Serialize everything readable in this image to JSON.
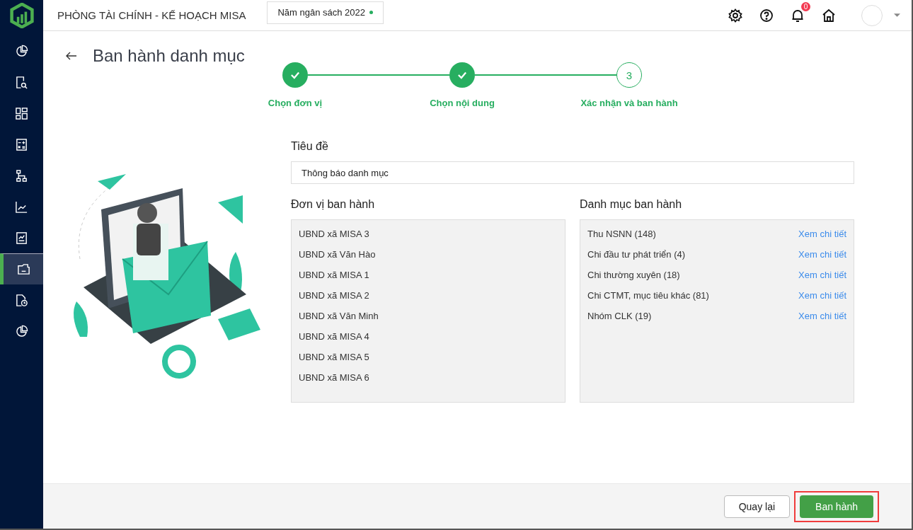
{
  "sidebar": {
    "items": [
      {
        "kind": "pie",
        "selected": false
      },
      {
        "kind": "docsearch",
        "selected": false
      },
      {
        "kind": "dashboard",
        "selected": false
      },
      {
        "kind": "calculator",
        "selected": false
      },
      {
        "kind": "hierarchy",
        "selected": false
      },
      {
        "kind": "linechart",
        "selected": false
      },
      {
        "kind": "report",
        "selected": false
      },
      {
        "kind": "folder",
        "selected": true
      },
      {
        "kind": "docclock",
        "selected": false
      },
      {
        "kind": "pie",
        "selected": false
      }
    ]
  },
  "header": {
    "title": "PHÒNG TÀI CHÍNH - KẾ HOẠCH MISA",
    "budget_year": "Năm ngân sách 2022",
    "notification_count": "0"
  },
  "page": {
    "title": "Ban hành danh mục"
  },
  "steps": [
    {
      "label": "Chọn đơn vị",
      "done": true
    },
    {
      "label": "Chọn nội dung",
      "done": true
    },
    {
      "label": "Xác nhận và ban hành",
      "done": false,
      "number": "3"
    }
  ],
  "form": {
    "title_label": "Tiêu đề",
    "title_value": "Thông báo danh mục",
    "units_label": "Đơn vị ban hành",
    "units": [
      "UBND xã MISA 3",
      "UBND xã Văn Hào",
      "UBND xã MISA 1",
      "UBND xã MISA 2",
      "UBND xã Văn Minh",
      "UBND xã MISA 4",
      "UBND xã MISA 5",
      "UBND xã MISA 6"
    ],
    "categories_label": "Danh mục ban hành",
    "categories": [
      {
        "name": "Thu NSNN (148)",
        "link": "Xem chi tiết"
      },
      {
        "name": "Chi đầu tư phát triển (4)",
        "link": "Xem chi tiết"
      },
      {
        "name": "Chi thường xuyên (18)",
        "link": "Xem chi tiết"
      },
      {
        "name": "Chi CTMT, mục tiêu khác (81)",
        "link": "Xem chi tiết"
      },
      {
        "name": "Nhóm CLK (19)",
        "link": "Xem chi tiết"
      }
    ]
  },
  "footer": {
    "buttons": [
      {
        "label": "Quay lại",
        "kind": "secondary",
        "highlighted": false
      },
      {
        "label": "Ban hành",
        "kind": "primary",
        "highlighted": true
      }
    ]
  }
}
